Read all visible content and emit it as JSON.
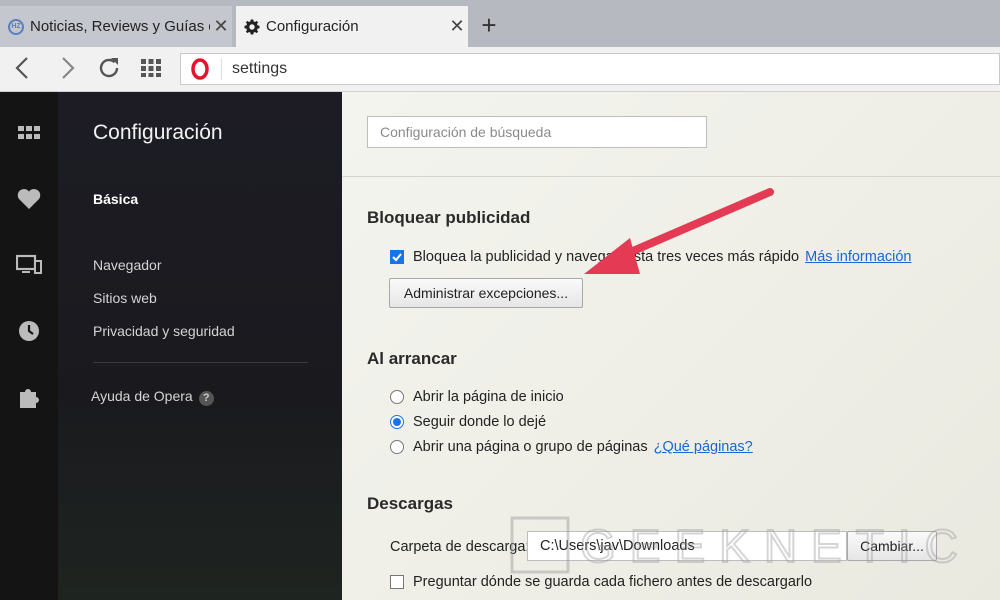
{
  "tabs": [
    {
      "title": "Noticias, Reviews y Guías d",
      "favicon": "hz-favicon"
    },
    {
      "title": "Configuración",
      "favicon": "gear-icon"
    }
  ],
  "address": {
    "url": "settings"
  },
  "sidebar": {
    "title": "Configuración",
    "items": [
      {
        "label": "Básica"
      },
      {
        "label": "Navegador"
      },
      {
        "label": "Sitios web"
      },
      {
        "label": "Privacidad y seguridad"
      }
    ],
    "help_label": "Ayuda de Opera",
    "help_glyph": "?"
  },
  "main": {
    "search_placeholder": "Configuración de búsqueda",
    "adblock": {
      "heading": "Bloquear publicidad",
      "checkbox_label": "Bloquea la publicidad y navega hasta tres veces más rápido",
      "checked": true,
      "more_info": "Más información",
      "exceptions_button": "Administrar excepciones..."
    },
    "startup": {
      "heading": "Al arrancar",
      "options": [
        {
          "label": "Abrir la página de inicio",
          "selected": false
        },
        {
          "label": "Seguir donde lo dejé",
          "selected": true
        },
        {
          "label": "Abrir una página o grupo de páginas",
          "selected": false
        }
      ],
      "which_pages_link": "¿Qué páginas?"
    },
    "downloads": {
      "heading": "Descargas",
      "folder_label": "Carpeta de descarga:",
      "folder_path": "C:\\Users\\jav\\Downloads",
      "change_button": "Cambiar...",
      "ask_label": "Preguntar dónde se guarda cada fichero antes de descargarlo",
      "ask_checked": false
    }
  },
  "watermark": {
    "text": "GEEKNETIC"
  },
  "colors": {
    "accent": "#1b73e8",
    "arrow": "#e43a54",
    "sidebar_bg": "#1b1b20"
  }
}
